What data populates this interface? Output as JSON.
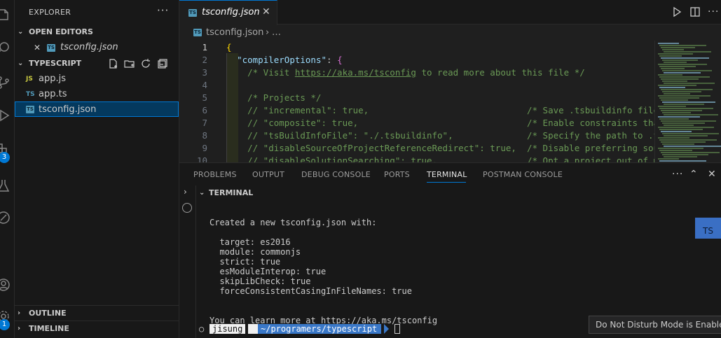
{
  "sidebar": {
    "title": "EXPLORER",
    "more_label": "···",
    "open_editors": {
      "label": "OPEN EDITORS",
      "files": [
        {
          "name": "tsconfig.json",
          "close": "✕",
          "icon": "ts-config-icon"
        }
      ]
    },
    "project": {
      "label": "TYPESCRIPT",
      "files": [
        {
          "name": "app.js",
          "icon_text": "JS"
        },
        {
          "name": "app.ts",
          "icon_text": "TS"
        },
        {
          "name": "tsconfig.json",
          "icon_text": "TS"
        }
      ]
    },
    "outline_label": "OUTLINE",
    "timeline_label": "TIMELINE"
  },
  "activity_bar": {
    "source_control_badge": "3",
    "accounts_badge": "1"
  },
  "editor": {
    "tab_label": "tsconfig.json",
    "tab_close": "✕",
    "breadcrumb_file": "tsconfig.json",
    "breadcrumb_more": "…",
    "lines": [
      {
        "n": "1",
        "html_parts": [
          {
            "t": "{",
            "c": "br1"
          }
        ]
      },
      {
        "n": "2",
        "html_parts": [
          {
            "t": "  ",
            "c": ""
          },
          {
            "t": "\"compilerOptions\"",
            "c": "key"
          },
          {
            "t": ": ",
            "c": ""
          },
          {
            "t": "{",
            "c": "br2"
          }
        ]
      },
      {
        "n": "3",
        "html_parts": [
          {
            "t": "    /* Visit ",
            "c": "cm"
          },
          {
            "t": "https://aka.ms/tsconfig",
            "c": "lnk"
          },
          {
            "t": " to read more about this file */",
            "c": "cm"
          }
        ]
      },
      {
        "n": "4",
        "html_parts": []
      },
      {
        "n": "5",
        "html_parts": [
          {
            "t": "    /* Projects */",
            "c": "cm"
          }
        ]
      },
      {
        "n": "6",
        "html_parts": [
          {
            "t": "    // \"incremental\": true,                              /* Save .tsbuildinfo files t",
            "c": "cm"
          }
        ]
      },
      {
        "n": "7",
        "html_parts": [
          {
            "t": "    // \"composite\": true,                                /* Enable constraints that a",
            "c": "cm"
          }
        ]
      },
      {
        "n": "8",
        "html_parts": [
          {
            "t": "    // \"tsBuildInfoFile\": \"./.tsbuildinfo\",              /* Specify the path to .tsbu",
            "c": "cm"
          }
        ]
      },
      {
        "n": "9",
        "html_parts": [
          {
            "t": "    // \"disableSourceOfProjectReferenceRedirect\": true,  /* Disable preferring source",
            "c": "cm"
          }
        ]
      },
      {
        "n": "10",
        "html_parts": [
          {
            "t": "    // \"disableSolutionSearching\": true,                 /* Opt a project out of mult",
            "c": "cm"
          }
        ]
      }
    ]
  },
  "panel": {
    "tabs": [
      "PROBLEMS",
      "OUTPUT",
      "DEBUG CONSOLE",
      "PORTS",
      "TERMINAL",
      "POSTMAN CONSOLE"
    ],
    "active_tab": "TERMINAL",
    "more_label": "···",
    "section_label": "TERMINAL",
    "side_badge": "TS",
    "terminal_lines": [
      "Created a new tsconfig.json with:",
      "",
      "  target: es2016",
      "  module: commonjs",
      "  strict: true",
      "  esModuleInterop: true",
      "  skipLibCheck: true",
      "  forceConsistentCasingInFileNames: true",
      "",
      "",
      "You can learn more at https://aka.ms/tsconfig"
    ],
    "prompt": {
      "bullet": "○",
      "user": "jisung",
      "path": "~/programers/typescript"
    }
  },
  "toast": {
    "message": "Do Not Disturb Mode is Enabled"
  },
  "colors": {
    "accent": "#0078d4",
    "selection": "#04395e",
    "comment": "#6a9955"
  }
}
